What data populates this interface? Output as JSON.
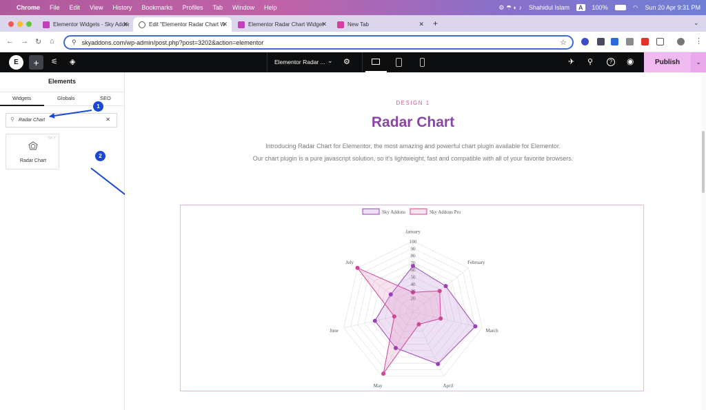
{
  "menubar": {
    "app": "Chrome",
    "items": [
      "File",
      "Edit",
      "View",
      "History",
      "Bookmarks",
      "Profiles",
      "Tab",
      "Window",
      "Help"
    ],
    "user": "Shahidul Islam",
    "input_source": "A",
    "battery": "100%",
    "datetime": "Sun 20 Apr  9:31 PM"
  },
  "tabs": [
    {
      "title": "Elementor Widgets - Sky Addons",
      "fav_color": "#c43dbd"
    },
    {
      "title": "Edit \"Elementor Radar Chart Widget\"",
      "fav_color": "#555555"
    },
    {
      "title": "Elementor Radar Chart Widget",
      "fav_color": "#c43dbd"
    },
    {
      "title": "New Tab",
      "fav_color": "#d63ea0"
    }
  ],
  "address": {
    "url": "skyaddons.com/wp-admin/post.php?post=3202&action=elementor"
  },
  "editor": {
    "document_title": "Elementor Radar ...",
    "publish_label": "Publish"
  },
  "panel": {
    "title": "Elements",
    "tabs": [
      "Widgets",
      "Globals",
      "SEO"
    ],
    "search_value": "Radar Chart",
    "widget": {
      "label": "Radar Chart",
      "badge": "SKY"
    }
  },
  "annotations": {
    "step1": "1",
    "step2": "2"
  },
  "content": {
    "design_label": "DESIGN 1",
    "heading": "Radar Chart",
    "para1": "Introducing Radar Chart for Elementor, the most amazing and powerful chart plugin available for Elementor.",
    "para2": "Our chart plugin is a pure javascript solution, so it's lightweight, fast and compatible with all of your favorite browsers."
  },
  "chart_data": {
    "type": "radar",
    "categories": [
      "January",
      "February",
      "March",
      "April",
      "May",
      "June",
      "July"
    ],
    "ticks": [
      20,
      30,
      40,
      50,
      60,
      70,
      80,
      90,
      100
    ],
    "rlim": [
      0,
      100
    ],
    "legend_position": "top",
    "series": [
      {
        "name": "Sky Addons",
        "values": [
          65,
          59,
          90,
          81,
          56,
          55,
          40
        ],
        "color": "#9b3fb5",
        "fill": "rgba(179,120,210,0.22)"
      },
      {
        "name": "Sky Addons Pro",
        "values": [
          28,
          48,
          40,
          19,
          96,
          27,
          100
        ],
        "color": "#d1449a",
        "fill": "rgba(230,140,190,0.25)"
      }
    ]
  }
}
